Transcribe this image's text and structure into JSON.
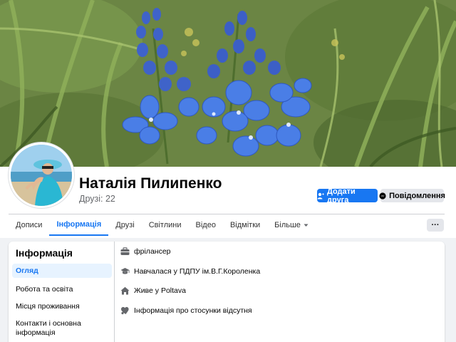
{
  "profile": {
    "name": "Наталія Пилипенко",
    "friends": "Друзі: 22"
  },
  "actions": {
    "add_friend": "Додати друга",
    "message": "Повідомлення"
  },
  "tabs": [
    {
      "label": "Дописи"
    },
    {
      "label": "Інформація",
      "active": true
    },
    {
      "label": "Друзі"
    },
    {
      "label": "Світлини"
    },
    {
      "label": "Відео"
    },
    {
      "label": "Відмітки"
    },
    {
      "label": "Більше"
    }
  ],
  "more_button": "···",
  "about": {
    "title": "Інформація",
    "nav": [
      {
        "label": "Огляд",
        "active": true
      },
      {
        "label": "Робота та освіта"
      },
      {
        "label": "Місця проживання"
      },
      {
        "label": "Контакти і основна інформація"
      }
    ],
    "overview": [
      {
        "icon": "briefcase-icon",
        "text": "фрілансер"
      },
      {
        "icon": "graduation-cap-icon",
        "text": "Навчалася у ПДПУ ім.В.Г.Короленка"
      },
      {
        "icon": "home-icon",
        "text_prefix": "Живе у ",
        "text_strong": "Poltava"
      },
      {
        "icon": "heart-icon",
        "text": "Інформація про стосунки відсутня"
      }
    ]
  },
  "colors": {
    "accent": "#1877f2",
    "active_nav_bg": "#e7f3ff",
    "page_bg": "#f0f2f5"
  }
}
